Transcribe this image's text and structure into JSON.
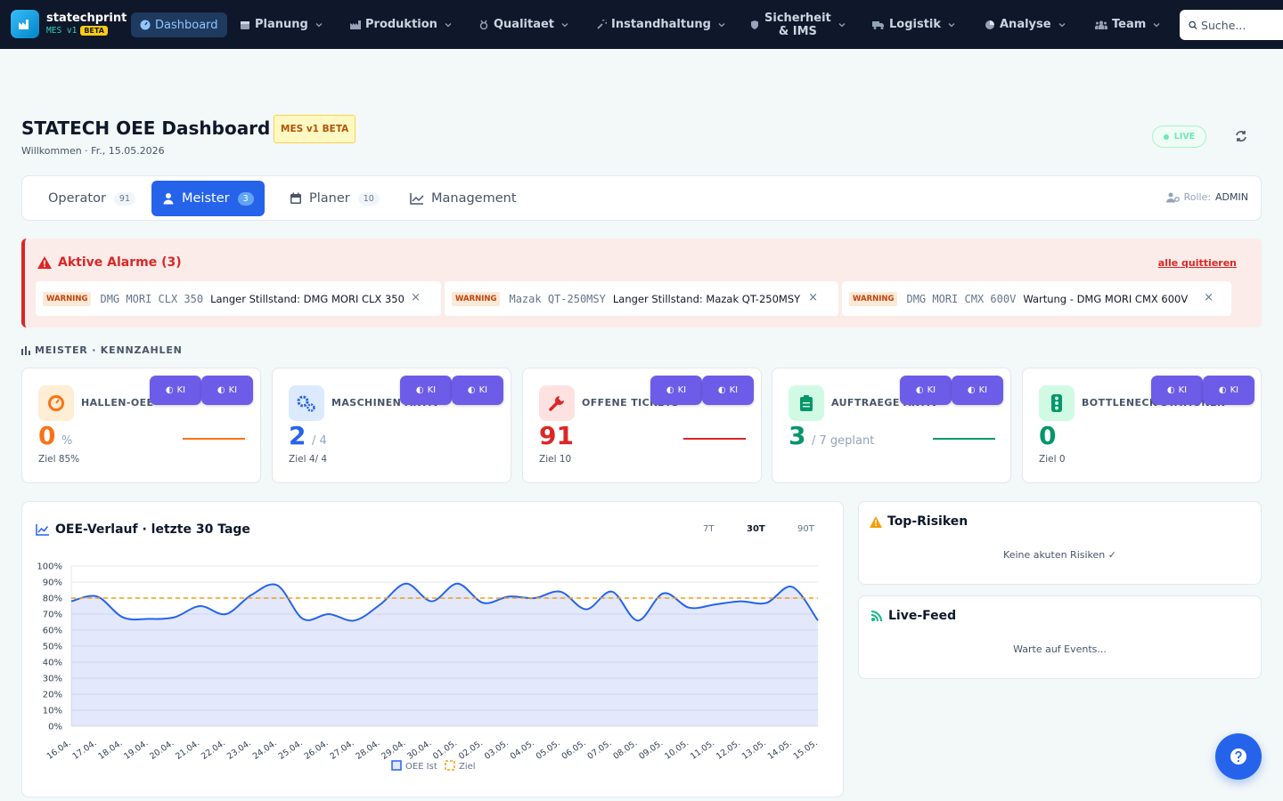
{
  "brand": {
    "name": "statechprint",
    "sub": "MES v1",
    "beta": "BETA"
  },
  "nav": {
    "items": [
      {
        "label": "Dashboard"
      },
      {
        "label": "Planung"
      },
      {
        "label": "Produktion"
      },
      {
        "label": "Qualitaet"
      },
      {
        "label": "Instandhaltung"
      },
      {
        "label_line1": "Sicherheit",
        "label_line2": "& IMS"
      },
      {
        "label": "Logistik"
      },
      {
        "label": "Analyse"
      },
      {
        "label": "Team"
      }
    ],
    "search_placeholder": "Suche..."
  },
  "header": {
    "title": "STATECH OEE Dashboard",
    "version_badge": "MES v1 BETA",
    "subtitle": "Willkommen · Fr., 15.05.2026",
    "live": "LIVE"
  },
  "tabs": [
    {
      "label": "Operator",
      "count": "91"
    },
    {
      "label": "Meister",
      "count": "3"
    },
    {
      "label": "Planer",
      "count": "10"
    },
    {
      "label": "Management"
    }
  ],
  "role": {
    "label": "Rolle:",
    "value": "ADMIN"
  },
  "alarms": {
    "title": "Aktive Alarme (3)",
    "ack_label": "alle quittieren",
    "items": [
      {
        "level": "WARNING",
        "machine": "DMG MORI CLX 350",
        "message": "Langer Stillstand: DMG MORI CLX 350",
        "close": "×"
      },
      {
        "level": "WARNING",
        "machine": "Mazak QT-250MSY",
        "message": "Langer Stillstand: Mazak QT-250MSY",
        "close": "×"
      },
      {
        "level": "WARNING",
        "machine": "DMG MORI CMX 600V",
        "message": "Wartung - DMG MORI CMX 600V",
        "close": "×"
      }
    ]
  },
  "kpis": {
    "section_label": "MEISTER · KENNZAHLEN",
    "ki_label": "KI",
    "items": [
      {
        "label": "HALLEN-OEE",
        "value": "0",
        "unit": "%",
        "goal": "Ziel 85%",
        "color": "#f97316"
      },
      {
        "label": "MASCHINEN AKTIV",
        "value": "2",
        "unit": "/ 4",
        "goal": "Ziel 4/ 4",
        "color": "#2563eb"
      },
      {
        "label": "OFFENE TICKETS",
        "value": "91",
        "unit": "",
        "goal": "Ziel 10",
        "color": "#dc2626"
      },
      {
        "label": "AUFTRAEGE AKTIV",
        "value": "3",
        "unit": "/ 7 geplant",
        "goal": "",
        "color": "#059669"
      },
      {
        "label": "BOTTLENECK-STATIONEN",
        "value": "0",
        "unit": "",
        "goal": "Ziel 0",
        "color": "#059669"
      }
    ]
  },
  "chart": {
    "title": "OEE-Verlauf · letzte 30 Tage",
    "ranges": [
      "7T",
      "30T",
      "90T"
    ],
    "active_range": "30T"
  },
  "chart_data": {
    "type": "area",
    "x": [
      "16.04.",
      "17.04.",
      "18.04.",
      "19.04.",
      "20.04.",
      "21.04.",
      "22.04.",
      "23.04.",
      "24.04.",
      "25.04.",
      "26.04.",
      "27.04.",
      "28.04.",
      "29.04.",
      "30.04.",
      "01.05.",
      "02.05.",
      "03.05.",
      "04.05.",
      "05.05.",
      "06.05.",
      "07.05.",
      "08.05.",
      "09.05.",
      "10.05.",
      "11.05.",
      "12.05.",
      "13.05.",
      "14.05.",
      "15.05."
    ],
    "series": [
      {
        "name": "OEE Ist",
        "color": "#2563eb",
        "values": [
          78,
          81,
          68,
          67,
          68,
          75,
          70,
          82,
          88,
          67,
          70,
          66,
          76,
          89,
          78,
          89,
          77,
          81,
          80,
          84,
          73,
          84,
          66,
          83,
          74,
          76,
          78,
          77,
          87,
          66
        ]
      },
      {
        "name": "Ziel",
        "color": "#f59e0b",
        "values": [
          80,
          80,
          80,
          80,
          80,
          80,
          80,
          80,
          80,
          80,
          80,
          80,
          80,
          80,
          80,
          80,
          80,
          80,
          80,
          80,
          80,
          80,
          80,
          80,
          80,
          80,
          80,
          80,
          80,
          80
        ]
      }
    ],
    "yticks": [
      "0%",
      "10%",
      "20%",
      "30%",
      "40%",
      "50%",
      "60%",
      "70%",
      "80%",
      "90%",
      "100%"
    ],
    "ylim": [
      0,
      100
    ],
    "grid": true,
    "legend": "bottom"
  },
  "risks": {
    "title": "Top-Risiken",
    "empty": "Keine akuten Risiken ✓"
  },
  "feed": {
    "title": "Live-Feed",
    "empty": "Warte auf Events..."
  }
}
